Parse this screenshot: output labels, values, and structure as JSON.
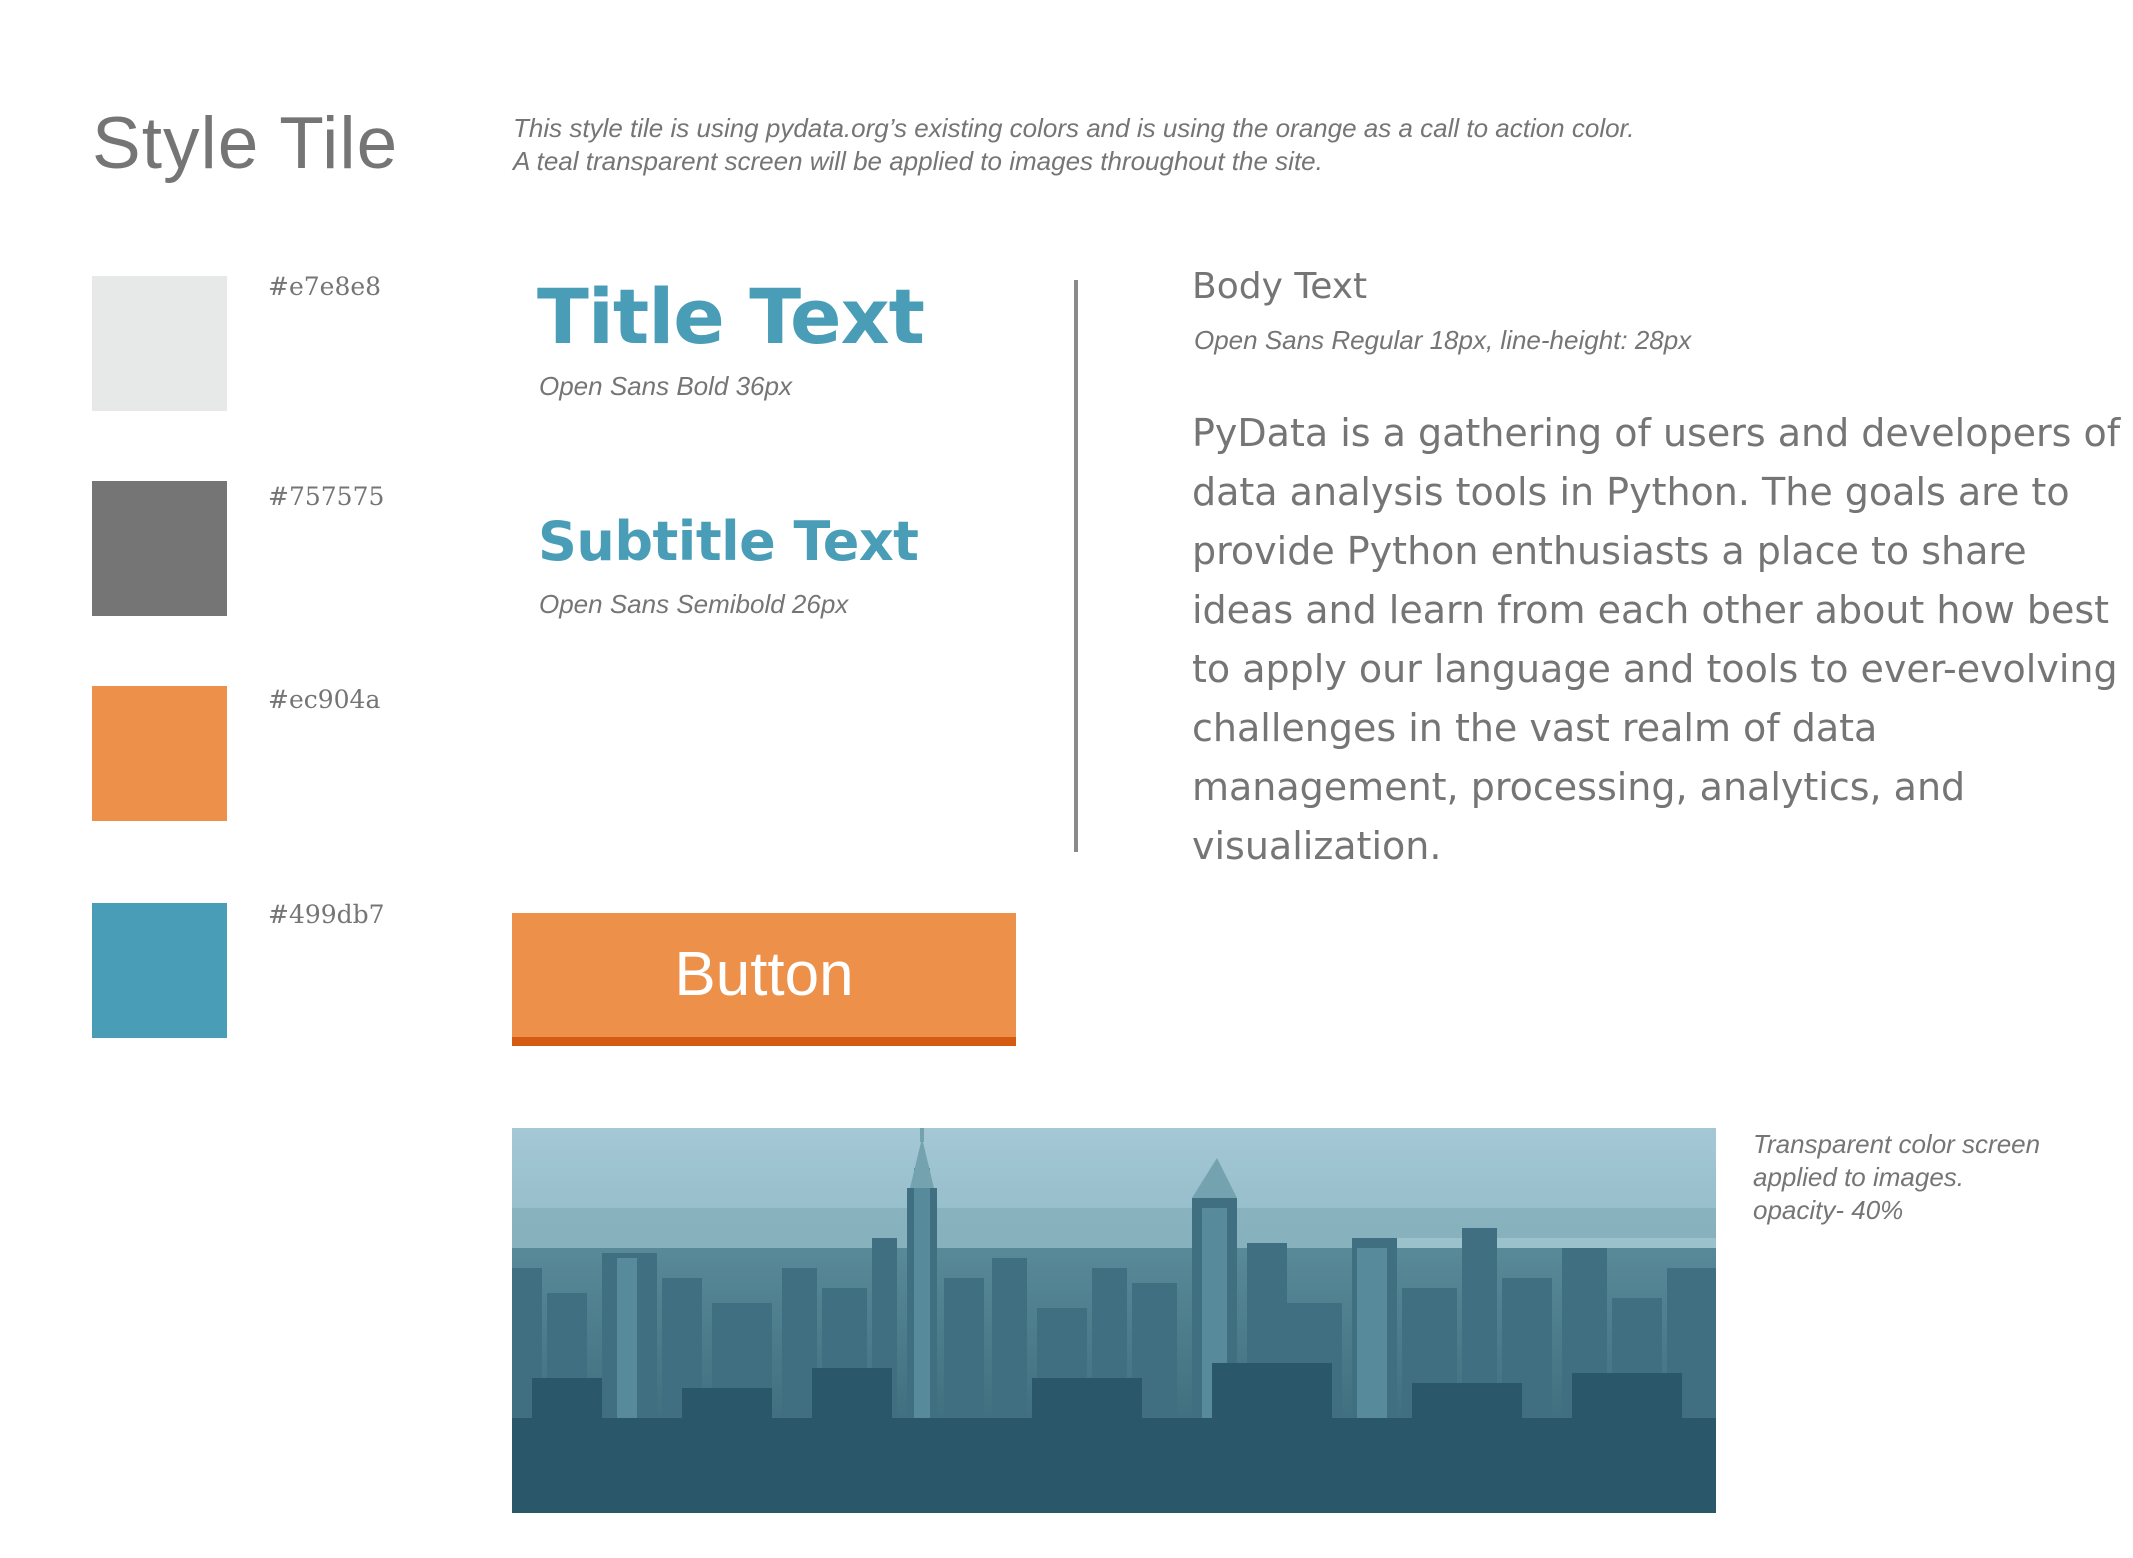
{
  "header": {
    "title": "Style Tile",
    "intro_line1": "This style tile is using pydata.org’s existing colors and is using the orange as a call to action color.",
    "intro_line2": "A teal transparent screen will be applied to images throughout the site."
  },
  "palette": [
    {
      "hex": "#e7e8e8",
      "label": "#e7e8e8"
    },
    {
      "hex": "#757575",
      "label": "#757575"
    },
    {
      "hex": "#ec904a",
      "label": "#ec904a"
    },
    {
      "hex": "#499db7",
      "label": "#499db7"
    }
  ],
  "typography": {
    "title_sample": "Title Text",
    "title_spec": "Open Sans Bold 36px",
    "subtitle_sample": "Subtitle Text",
    "subtitle_spec": "Open Sans Semibold 26px"
  },
  "body": {
    "heading": "Body Text",
    "spec": "Open Sans Regular 18px, line-height: 28px",
    "paragraph": "PyData is a gathering of users and developers of data analysis tools in Python. The goals are to provide Python enthusiasts a place to share ideas and learn from each other about how best to apply our language and tools to ever-evolving challenges in the vast realm of data management, processing, analytics, and visualization."
  },
  "button": {
    "label": "Button",
    "color": "#ec904a",
    "border_color": "#d55a12"
  },
  "image": {
    "caption_line1": "Transparent color screen",
    "caption_line2": "applied to images.",
    "caption_line3": "opacity- 40%",
    "overlay_color": "#499db7",
    "overlay_opacity": 0.4
  }
}
